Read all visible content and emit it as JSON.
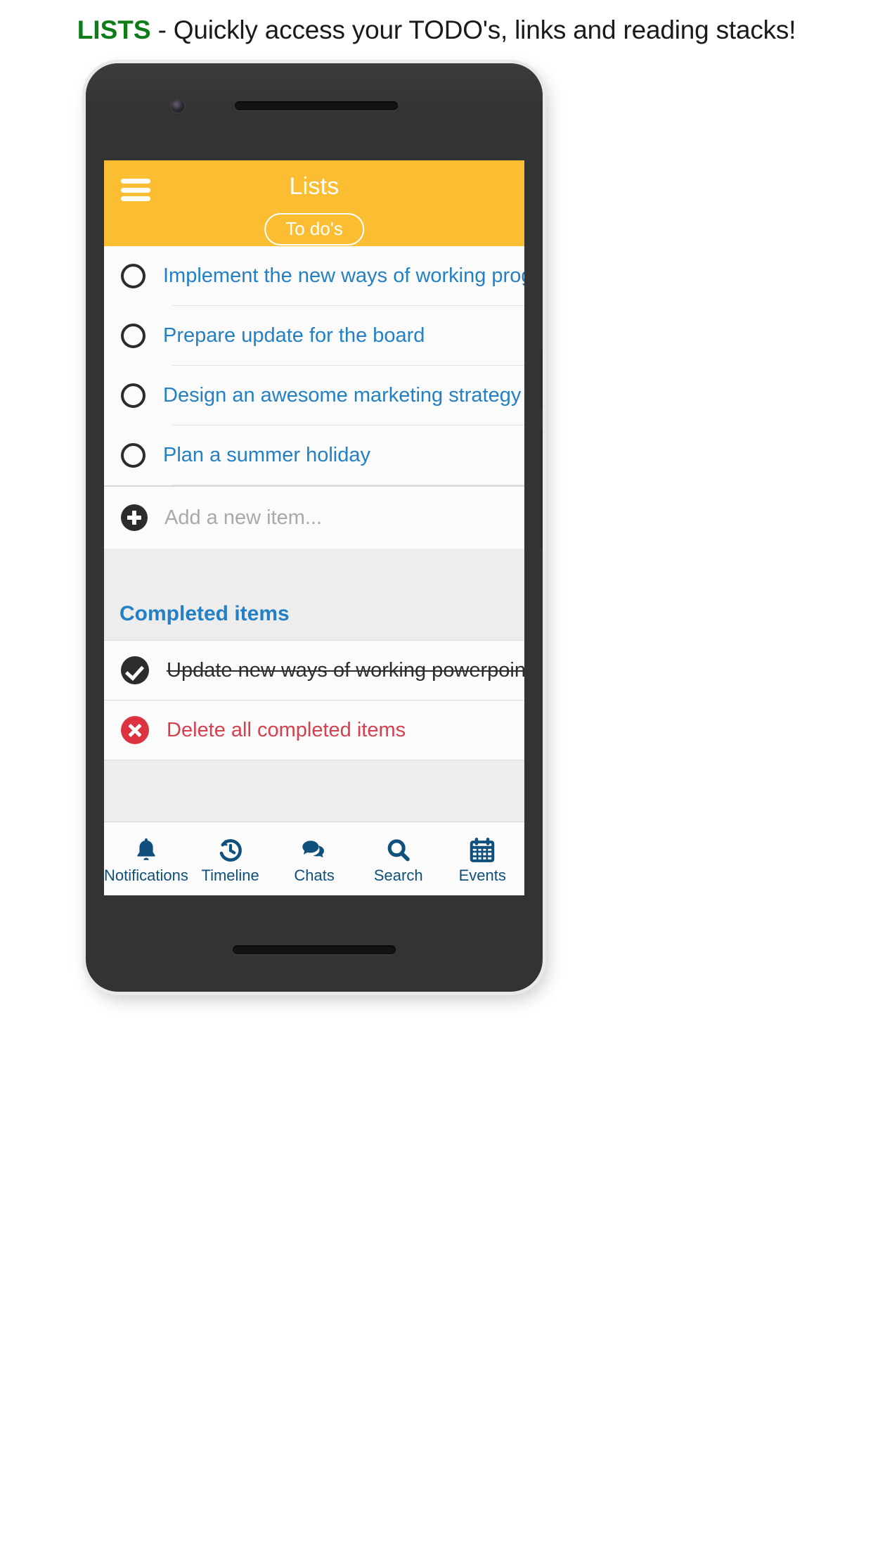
{
  "caption": {
    "highlight": "LISTS",
    "rest": " - Quickly access your TODO's, links and reading stacks!"
  },
  "appbar": {
    "title": "Lists",
    "menu_icon": "hamburger-menu-icon",
    "filter_pill": "To do's",
    "background_color": "#FBBE33"
  },
  "todos": [
    {
      "label": "Implement the new ways of working program",
      "checked": false
    },
    {
      "label": "Prepare update for the board",
      "checked": false
    },
    {
      "label": "Design an awesome marketing strategy",
      "checked": false
    },
    {
      "label": "Plan a summer holiday",
      "checked": false
    }
  ],
  "add_item": {
    "icon": "plus-circle-icon",
    "placeholder": "Add a new item..."
  },
  "completed": {
    "header": "Completed items",
    "items": [
      {
        "label": "Update new ways of working powerpoint",
        "checked": true
      }
    ],
    "delete_all": {
      "label": "Delete all completed items",
      "icon": "x-circle-icon",
      "color": "#D5404E"
    }
  },
  "bottom_nav": [
    {
      "label": "Notifications",
      "icon": "bell-icon"
    },
    {
      "label": "Timeline",
      "icon": "history-clock-icon"
    },
    {
      "label": "Chats",
      "icon": "speech-bubbles-icon"
    },
    {
      "label": "Search",
      "icon": "magnifier-icon"
    },
    {
      "label": "Events",
      "icon": "calendar-icon"
    }
  ],
  "theme": {
    "accent_yellow": "#FBBE33",
    "link_blue": "#2380C4",
    "nav_navy": "#10507D",
    "danger_red": "#DD3240",
    "caption_green": "#0E7C18"
  }
}
